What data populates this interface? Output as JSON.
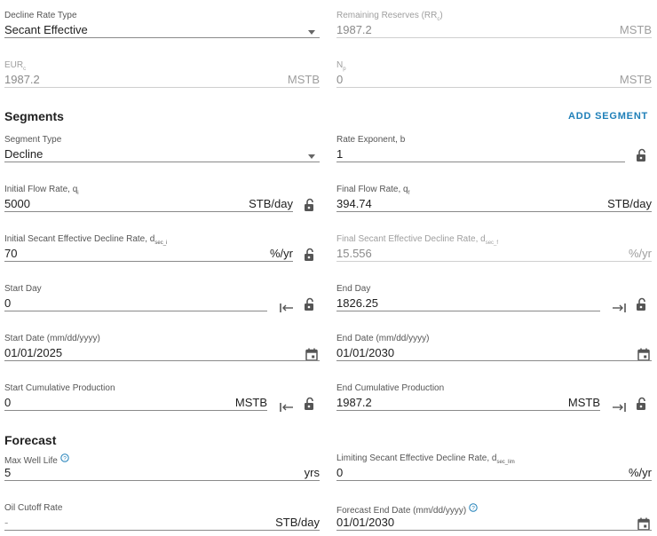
{
  "top": {
    "decline_rate_type": {
      "label": "Decline Rate Type",
      "value": "Secant Effective"
    },
    "remaining_reserves": {
      "label": "Remaining Reserves (RR",
      "sub": "c",
      "label_end": ")",
      "value": "1987.2",
      "unit": "MSTB"
    },
    "eur": {
      "label": "EUR",
      "sub": "c",
      "value": "1987.2",
      "unit": "MSTB"
    },
    "np": {
      "label": "N",
      "sub": "p",
      "value": "0",
      "unit": "MSTB"
    }
  },
  "segments": {
    "title": "Segments",
    "add_button": "ADD SEGMENT",
    "segment_type": {
      "label": "Segment Type",
      "value": "Decline"
    },
    "rate_exponent": {
      "label": "Rate Exponent, b",
      "value": "1"
    },
    "initial_flow_rate": {
      "label": "Initial Flow Rate, q",
      "sub": "i",
      "value": "5000",
      "unit": "STB/day"
    },
    "final_flow_rate": {
      "label": "Final Flow Rate, q",
      "sub": "f",
      "value": "394.74",
      "unit": "STB/day"
    },
    "initial_decline": {
      "label": "Initial Secant Effective Decline Rate, d",
      "sub": "sec_i",
      "value": "70",
      "unit": "%/yr"
    },
    "final_decline": {
      "label": "Final Secant Effective Decline Rate, d",
      "sub": "sec_f",
      "value": "15.556",
      "unit": "%/yr"
    },
    "start_day": {
      "label": "Start Day",
      "value": "0"
    },
    "end_day": {
      "label": "End Day",
      "value": "1826.25"
    },
    "start_date": {
      "label": "Start Date (mm/dd/yyyy)",
      "value": "01/01/2025"
    },
    "end_date": {
      "label": "End Date (mm/dd/yyyy)",
      "value": "01/01/2030"
    },
    "start_cum": {
      "label": "Start Cumulative Production",
      "value": "0",
      "unit": "MSTB"
    },
    "end_cum": {
      "label": "End Cumulative Production",
      "value": "1987.2",
      "unit": "MSTB"
    }
  },
  "forecast": {
    "title": "Forecast",
    "max_well_life": {
      "label": "Max Well Life",
      "value": "5",
      "unit": "yrs"
    },
    "limiting_decline": {
      "label": "Limiting Secant Effective Decline Rate, d",
      "sub": "sec_lim",
      "value": "0",
      "unit": "%/yr"
    },
    "oil_cutoff": {
      "label": "Oil Cutoff Rate",
      "value": "-",
      "unit": "STB/day"
    },
    "forecast_end_date": {
      "label": "Forecast End Date (mm/dd/yyyy)",
      "value": "01/01/2030"
    }
  },
  "colors": {
    "accent": "#1e7fb8",
    "text": "#212121",
    "label": "#555555",
    "disabled": "#9e9e9e",
    "underline": "#8a8a8a"
  },
  "icons": {
    "lock": "lock-open-icon",
    "calendar": "calendar-icon",
    "to_start": "arrow-to-start-icon",
    "to_end": "arrow-to-end-icon",
    "help": "help-circle-icon",
    "dropdown": "caret-down-icon"
  }
}
